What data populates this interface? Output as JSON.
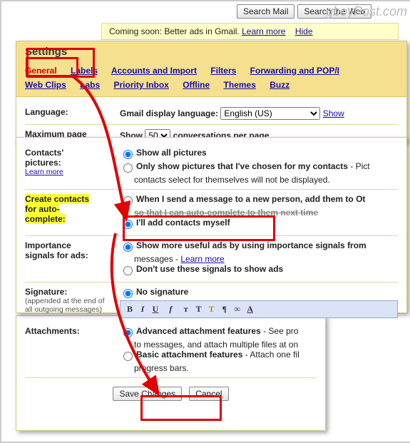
{
  "watermark": "gboyPost.com",
  "topButtons": {
    "searchMail": "Search Mail",
    "searchWeb": "Search the Web"
  },
  "promo": {
    "text": "Coming soon: Better ads in Gmail.",
    "learn": "Learn more",
    "hide": "Hide"
  },
  "heading": "Settings",
  "tabs": {
    "general": "General",
    "labels": "Labels",
    "accounts": "Accounts and Import",
    "filters": "Filters",
    "forwarding": "Forwarding and POP/I",
    "webclips": "Web Clips",
    "labs": "Labs",
    "priority": "Priority Inbox",
    "offline": "Offline",
    "themes": "Themes",
    "buzz": "Buzz"
  },
  "language": {
    "label": "Language:",
    "sub": "Gmail display language:",
    "value": "English (US)",
    "show": "Show"
  },
  "maxpage": {
    "label": "Maximum page",
    "show": "Show",
    "size": "50",
    "after": "conversations per page"
  },
  "contacts": {
    "label1": "Contacts'",
    "label2": "pictures:",
    "learn": "Learn more",
    "opt1": "Show all pictures",
    "opt2a": "Only show pictures that I've chosen for my contacts",
    "opt2b": " - Pict",
    "opt2c": "contacts select for themselves will not be displayed."
  },
  "autoc": {
    "label1": "Create contacts",
    "label2": "for auto-",
    "label3": "complete:",
    "opt1a": "When I send a message to a new person, add them to Ot",
    "opt1b": "so that I can auto-complete to them next time",
    "opt2": "I'll add contacts myself"
  },
  "impads": {
    "label1": "Importance",
    "label2": "signals for ads:",
    "opt1": "Show more useful ads by using importance signals from",
    "opt1b": "messages - ",
    "learn": "Learn more",
    "opt2": "Don't use these signals to show ads"
  },
  "sig": {
    "label": "Signature:",
    "sub1": "(appended at the end of",
    "sub2": "all outgoing messages)",
    "opt1": "No signature"
  },
  "attach": {
    "label": "Attachments:",
    "opt1a": "Advanced attachment features",
    "opt1b": " - See pro",
    "opt1c": "to messages, and attach multiple files at on",
    "opt2a": "Basic attachment features",
    "opt2b": " - Attach one fil",
    "opt2c": "progress bars."
  },
  "buttons": {
    "save": "Save Changes",
    "cancel": "Cancel"
  }
}
